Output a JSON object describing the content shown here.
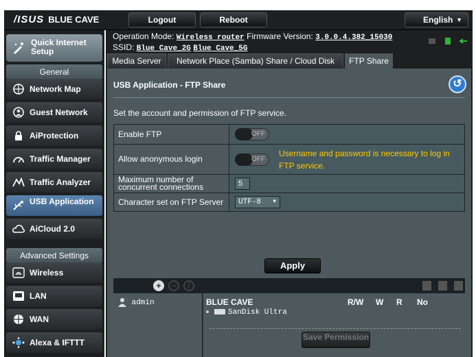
{
  "topbar": {
    "brand": "/ISUS",
    "product": "BLUE CAVE",
    "logout_label": "Logout",
    "reboot_label": "Reboot",
    "language": "English"
  },
  "sidebar": {
    "quick_setup": "Quick Internet Setup",
    "general_header": "General",
    "general_items": [
      {
        "label": "Network Map",
        "icon": "globe-icon"
      },
      {
        "label": "Guest Network",
        "icon": "guest-icon"
      },
      {
        "label": "AiProtection",
        "icon": "lock-icon"
      },
      {
        "label": "Traffic Manager",
        "icon": "gauge-icon"
      },
      {
        "label": "Traffic Analyzer",
        "icon": "chart-icon"
      },
      {
        "label": "USB Application",
        "icon": "usb-icon"
      },
      {
        "label": "AiCloud 2.0",
        "icon": "cloud-icon"
      }
    ],
    "advanced_header": "Advanced Settings",
    "advanced_items": [
      {
        "label": "Wireless",
        "icon": "wifi-icon"
      },
      {
        "label": "LAN",
        "icon": "monitor-icon"
      },
      {
        "label": "WAN",
        "icon": "globe-icon"
      },
      {
        "label": "Alexa & IFTTT",
        "icon": "alexa-icon"
      }
    ]
  },
  "info": {
    "mode_label": "Operation Mode:",
    "mode_value": "Wireless router",
    "fw_label": "Firmware Version:",
    "fw_value": "3.0.0.4.382_15030",
    "ssid_label": "SSID:",
    "ssid1": "Blue Cave_2G",
    "ssid2": "Blue Cave_5G"
  },
  "tabs": [
    "Media Server",
    "Network Place (Samba) Share / Cloud Disk",
    "FTP Share"
  ],
  "panel": {
    "title": "USB Application - FTP Share",
    "description": "Set the account and permission of FTP service.",
    "rows": {
      "enable_ftp": {
        "label": "Enable FTP",
        "state": "OFF"
      },
      "anonymous": {
        "label": "Allow anonymous login",
        "state": "OFF",
        "warning": "Username and password is necessary to log in FTP service."
      },
      "max_conn": {
        "label": "Maximum number of concurrent connections",
        "value": "5"
      },
      "charset": {
        "label": "Character set on FTP Server",
        "value": "UTF-8"
      }
    },
    "apply_label": "Apply"
  },
  "accounts": {
    "user": "admin",
    "device": "BLUE CAVE",
    "perm_headers": [
      "R/W",
      "W",
      "R",
      "No"
    ],
    "disk": "SanDisk Ultra",
    "save_label": "Save Permission"
  },
  "colors": {
    "panel": "#4d595d",
    "background": "#1d1f21",
    "active_nav": "#5b84ae",
    "warning": "#ffcc00"
  }
}
